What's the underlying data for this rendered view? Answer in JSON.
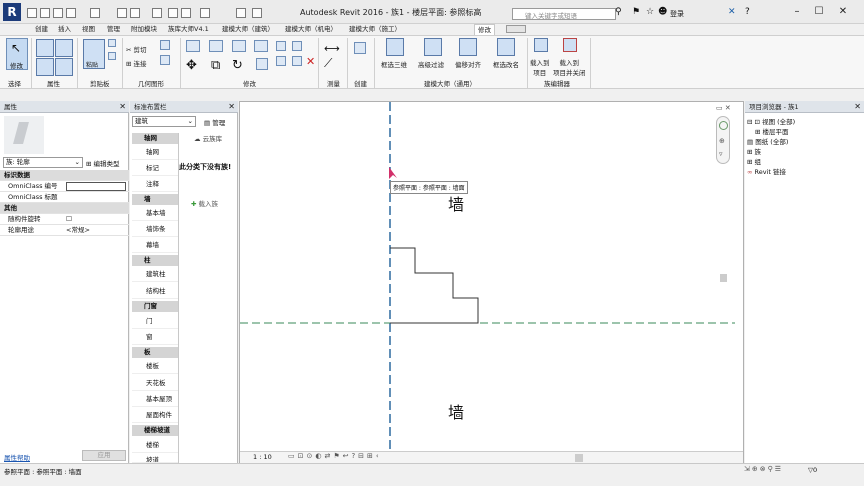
{
  "app": {
    "title": "Autodesk Revit 2016 -",
    "doc": "族1 - 楼层平面: 参照标高",
    "search_placeholder": "键入关键字或短语",
    "user": "登录",
    "logo": "R"
  },
  "tabs": [
    "创建",
    "插入",
    "视图",
    "管理",
    "附加模块",
    "族库大师V4.1",
    "建模大师（建筑）",
    "建模大师（机电）",
    "建模大师（施工）",
    "修改"
  ],
  "active_tab": "修改",
  "ribbon": {
    "modify_label": "修改",
    "panels": [
      "选择",
      "属性",
      "剪贴板",
      "几何图形",
      "修改",
      "测量",
      "创建",
      "建模大师（通用）",
      "族编辑器"
    ],
    "clipboard": {
      "cut": "剪切",
      "paste": "粘贴",
      "join": "连接"
    },
    "tools": [
      "框选三维",
      "高级过滤",
      "偏移对齐",
      "框选改名"
    ],
    "family": [
      "载入到\n项目",
      "载入到\n项目并关闭"
    ]
  },
  "properties": {
    "title": "属性",
    "family_select": "族: 轮廓",
    "edit_type": "编辑类型",
    "rows": [
      {
        "type": "section",
        "label": "标识数据"
      },
      {
        "label": "OmniClass 编号",
        "value": ""
      },
      {
        "label": "OmniClass 标题",
        "value": ""
      },
      {
        "type": "section",
        "label": "其他"
      },
      {
        "label": "随构件旋转",
        "value": "☐"
      },
      {
        "label": "轮廓用途",
        "value": "<常规>"
      }
    ],
    "help": "属性帮助",
    "apply": "应用"
  },
  "std_browser": {
    "title": "标准布置栏",
    "discipline": "建筑",
    "manage": "管理",
    "cloud": "云族库",
    "empty_msg": "此分类下没有族!",
    "load": "载入族",
    "categories": [
      {
        "name": "轴网",
        "items": [
          "轴网",
          "标记",
          "注释"
        ]
      },
      {
        "name": "墙",
        "items": [
          "基本墙",
          "墙饰条",
          "幕墙"
        ]
      },
      {
        "name": "柱",
        "items": [
          "建筑柱",
          "结构柱"
        ]
      },
      {
        "name": "门窗",
        "items": [
          "门",
          "窗"
        ]
      },
      {
        "name": "板",
        "items": [
          "楼板",
          "天花板",
          "基本屋顶",
          "屋面构件"
        ]
      },
      {
        "name": "楼梯坡道",
        "items": [
          "楼梯",
          "坡道"
        ]
      }
    ]
  },
  "canvas": {
    "tooltip": "参照平面 : 参照平面 : 墙面",
    "labels": [
      "墙",
      "墙"
    ],
    "scale": "1 : 10"
  },
  "project_browser": {
    "title": "项目浏览器 - 族1",
    "tree": [
      "视图 (全部)",
      "楼层平面",
      "图纸 (全部)",
      "族",
      "组",
      "Revit 链接"
    ]
  },
  "status": {
    "text": "参照平面 : 参照平面 : 墙面",
    "filter": "0"
  },
  "colors": {
    "accent": "#1c3b7a",
    "ref_plane": "#2d6a9f",
    "ref_plane_h": "#3a8a5a"
  }
}
